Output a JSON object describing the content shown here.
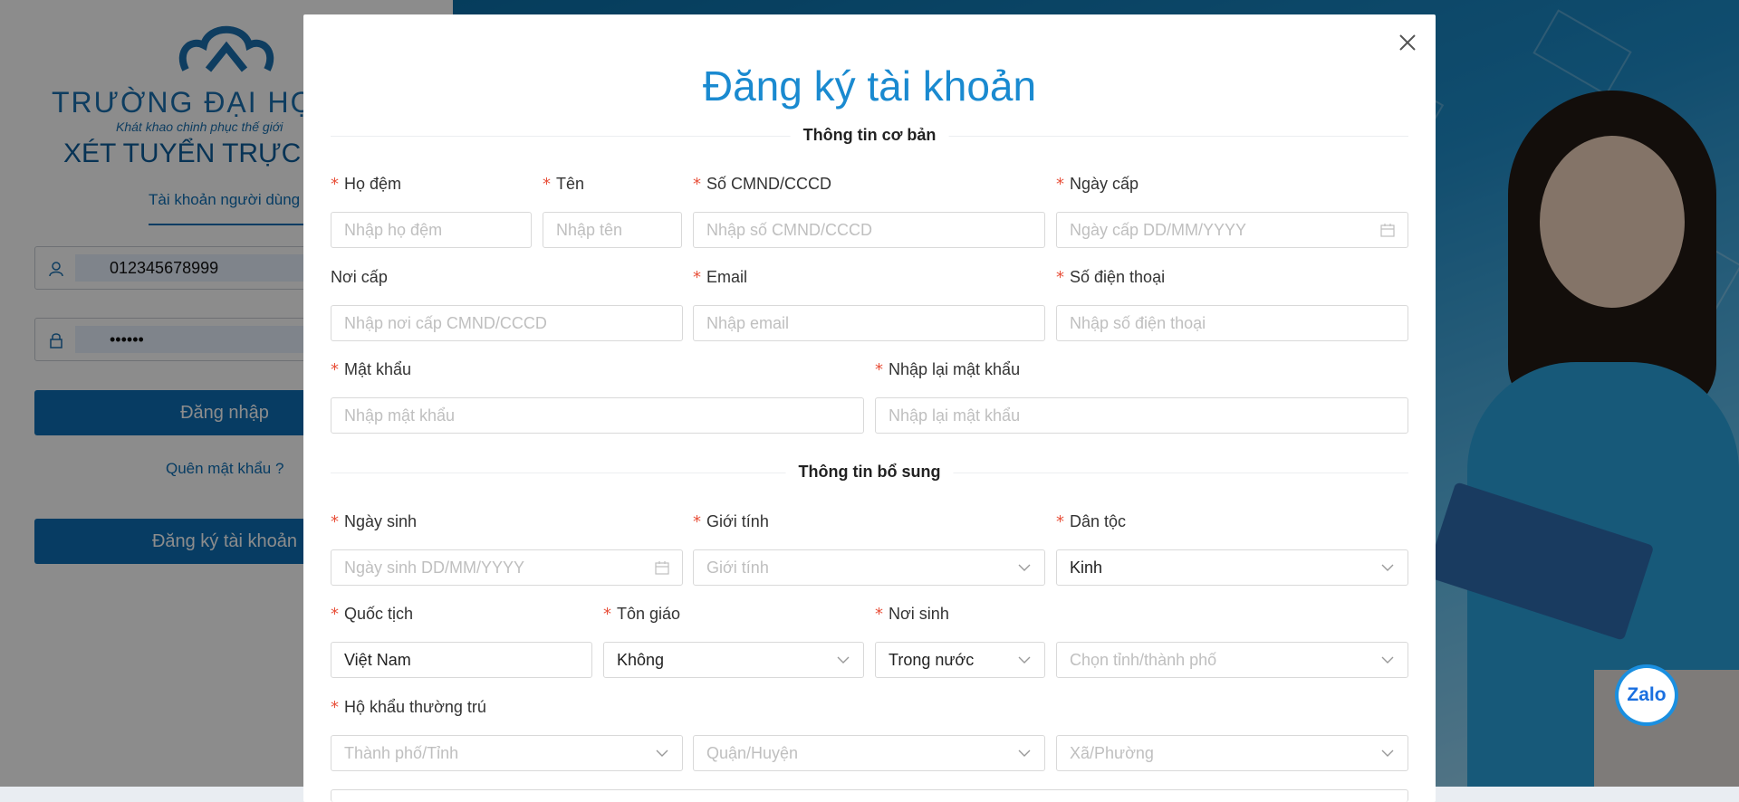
{
  "background": {
    "university_name": "TRƯỜNG ĐẠI HỌC",
    "slogan": "Khát khao chinh phục thế giới",
    "portal_title": "XÉT TUYỂN TRỰC TUYẾN",
    "tab_label": "Tài khoản người dùng",
    "username_value": "012345678999",
    "password_value": "••••••",
    "login_button": "Đăng nhập",
    "forgot_link": "Quên mật khẩu ?",
    "register_button": "Đăng ký tài khoản",
    "zalo_label": "Zalo"
  },
  "modal": {
    "title": "Đăng ký tài khoản",
    "section_basic": "Thông tin cơ bản",
    "section_extra": "Thông tin bổ sung",
    "required_mark": "*",
    "fields": {
      "ho_dem": {
        "label": "Họ đệm",
        "placeholder": "Nhập họ đệm"
      },
      "ten": {
        "label": "Tên",
        "placeholder": "Nhập tên"
      },
      "cmnd": {
        "label": "Số CMND/CCCD",
        "placeholder": "Nhập số CMND/CCCD"
      },
      "ngay_cap": {
        "label": "Ngày cấp",
        "placeholder": "Ngày cấp DD/MM/YYYY"
      },
      "noi_cap": {
        "label": "Nơi cấp",
        "placeholder": "Nhập nơi cấp CMND/CCCD"
      },
      "email": {
        "label": "Email",
        "placeholder": "Nhập email"
      },
      "so_dien_thoai": {
        "label": "Số điện thoại",
        "placeholder": "Nhập số điện thoại"
      },
      "mat_khau": {
        "label": "Mật khẩu",
        "placeholder": "Nhập mật khẩu"
      },
      "nhap_lai_mat_khau": {
        "label": "Nhập lại mật khẩu",
        "placeholder": "Nhập lại mật khẩu"
      },
      "ngay_sinh": {
        "label": "Ngày sinh",
        "placeholder": "Ngày sinh DD/MM/YYYY"
      },
      "gioi_tinh": {
        "label": "Giới tính",
        "placeholder": "Giới tính"
      },
      "dan_toc": {
        "label": "Dân tộc",
        "value": "Kinh"
      },
      "quoc_tich": {
        "label": "Quốc tịch",
        "value": "Việt Nam"
      },
      "ton_giao": {
        "label": "Tôn giáo",
        "value": "Không"
      },
      "noi_sinh": {
        "label": "Nơi sinh",
        "value": "Trong nước"
      },
      "tinh_thanh_pho": {
        "placeholder": "Chọn tỉnh/thành phố"
      },
      "ho_khau": {
        "label": "Hộ khẩu thường trú"
      },
      "thanh_pho_tinh": {
        "placeholder": "Thành phố/Tỉnh"
      },
      "quan_huyen": {
        "placeholder": "Quận/Huyện"
      },
      "xa_phuong": {
        "placeholder": "Xã/Phường"
      }
    }
  },
  "colors": {
    "accent": "#1a8ad0",
    "primary_button": "#0d6eb5",
    "required": "#e8503a",
    "placeholder": "#bfbfbf"
  }
}
